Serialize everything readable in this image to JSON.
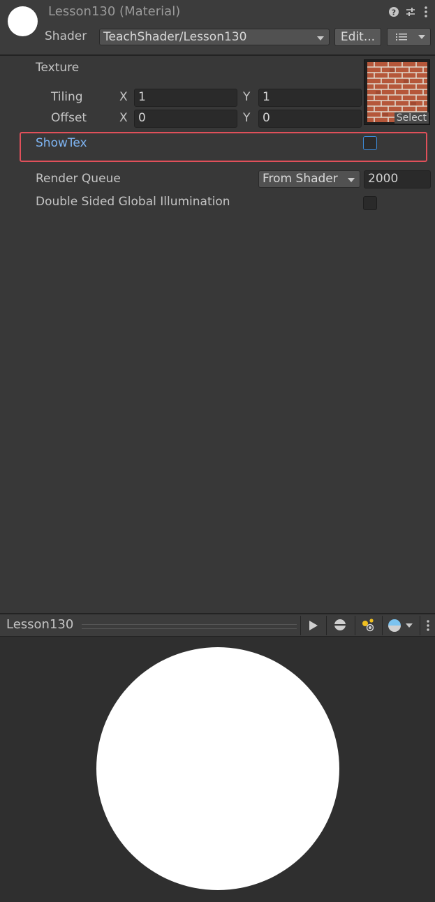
{
  "header": {
    "title": "Lesson130 (Material)",
    "shader_label": "Shader",
    "shader_value": "TeachShader/Lesson130",
    "edit_button": "Edit..."
  },
  "properties": {
    "texture_label": "Texture",
    "tiling_label": "Tiling",
    "offset_label": "Offset",
    "tiling_x": "1",
    "tiling_y": "1",
    "offset_x": "0",
    "offset_y": "0",
    "axis_x": "X",
    "axis_y": "Y",
    "select_label": "Select",
    "showtex_label": "ShowTex",
    "showtex_checked": false
  },
  "advanced": {
    "render_queue_label": "Render Queue",
    "render_queue_mode": "From Shader",
    "render_queue_value": "2000",
    "dsgi_label": "Double Sided Global Illumination",
    "dsgi_checked": false
  },
  "preview": {
    "title": "Lesson130"
  },
  "colors": {
    "background": "#383838",
    "highlight": "#e0505a",
    "property_accent": "#7fb6f5",
    "brick": "#b5573a"
  }
}
